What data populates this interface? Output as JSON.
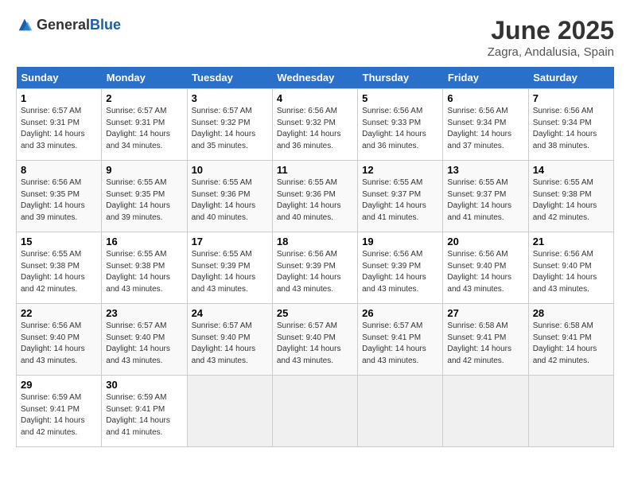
{
  "header": {
    "logo_general": "General",
    "logo_blue": "Blue",
    "title": "June 2025",
    "subtitle": "Zagra, Andalusia, Spain"
  },
  "calendar": {
    "days_of_week": [
      "Sunday",
      "Monday",
      "Tuesday",
      "Wednesday",
      "Thursday",
      "Friday",
      "Saturday"
    ],
    "weeks": [
      [
        {
          "day": "",
          "info": ""
        },
        {
          "day": "2",
          "info": "Sunrise: 6:57 AM\nSunset: 9:31 PM\nDaylight: 14 hours\nand 34 minutes."
        },
        {
          "day": "3",
          "info": "Sunrise: 6:57 AM\nSunset: 9:32 PM\nDaylight: 14 hours\nand 35 minutes."
        },
        {
          "day": "4",
          "info": "Sunrise: 6:56 AM\nSunset: 9:32 PM\nDaylight: 14 hours\nand 36 minutes."
        },
        {
          "day": "5",
          "info": "Sunrise: 6:56 AM\nSunset: 9:33 PM\nDaylight: 14 hours\nand 36 minutes."
        },
        {
          "day": "6",
          "info": "Sunrise: 6:56 AM\nSunset: 9:34 PM\nDaylight: 14 hours\nand 37 minutes."
        },
        {
          "day": "7",
          "info": "Sunrise: 6:56 AM\nSunset: 9:34 PM\nDaylight: 14 hours\nand 38 minutes."
        }
      ],
      [
        {
          "day": "1",
          "info": "Sunrise: 6:57 AM\nSunset: 9:31 PM\nDaylight: 14 hours\nand 33 minutes."
        },
        {
          "day": "",
          "info": ""
        },
        {
          "day": "",
          "info": ""
        },
        {
          "day": "",
          "info": ""
        },
        {
          "day": "",
          "info": ""
        },
        {
          "day": "",
          "info": ""
        },
        {
          "day": "",
          "info": ""
        }
      ],
      [
        {
          "day": "8",
          "info": "Sunrise: 6:56 AM\nSunset: 9:35 PM\nDaylight: 14 hours\nand 39 minutes."
        },
        {
          "day": "9",
          "info": "Sunrise: 6:55 AM\nSunset: 9:35 PM\nDaylight: 14 hours\nand 39 minutes."
        },
        {
          "day": "10",
          "info": "Sunrise: 6:55 AM\nSunset: 9:36 PM\nDaylight: 14 hours\nand 40 minutes."
        },
        {
          "day": "11",
          "info": "Sunrise: 6:55 AM\nSunset: 9:36 PM\nDaylight: 14 hours\nand 40 minutes."
        },
        {
          "day": "12",
          "info": "Sunrise: 6:55 AM\nSunset: 9:37 PM\nDaylight: 14 hours\nand 41 minutes."
        },
        {
          "day": "13",
          "info": "Sunrise: 6:55 AM\nSunset: 9:37 PM\nDaylight: 14 hours\nand 41 minutes."
        },
        {
          "day": "14",
          "info": "Sunrise: 6:55 AM\nSunset: 9:38 PM\nDaylight: 14 hours\nand 42 minutes."
        }
      ],
      [
        {
          "day": "15",
          "info": "Sunrise: 6:55 AM\nSunset: 9:38 PM\nDaylight: 14 hours\nand 42 minutes."
        },
        {
          "day": "16",
          "info": "Sunrise: 6:55 AM\nSunset: 9:38 PM\nDaylight: 14 hours\nand 43 minutes."
        },
        {
          "day": "17",
          "info": "Sunrise: 6:55 AM\nSunset: 9:39 PM\nDaylight: 14 hours\nand 43 minutes."
        },
        {
          "day": "18",
          "info": "Sunrise: 6:56 AM\nSunset: 9:39 PM\nDaylight: 14 hours\nand 43 minutes."
        },
        {
          "day": "19",
          "info": "Sunrise: 6:56 AM\nSunset: 9:39 PM\nDaylight: 14 hours\nand 43 minutes."
        },
        {
          "day": "20",
          "info": "Sunrise: 6:56 AM\nSunset: 9:40 PM\nDaylight: 14 hours\nand 43 minutes."
        },
        {
          "day": "21",
          "info": "Sunrise: 6:56 AM\nSunset: 9:40 PM\nDaylight: 14 hours\nand 43 minutes."
        }
      ],
      [
        {
          "day": "22",
          "info": "Sunrise: 6:56 AM\nSunset: 9:40 PM\nDaylight: 14 hours\nand 43 minutes."
        },
        {
          "day": "23",
          "info": "Sunrise: 6:57 AM\nSunset: 9:40 PM\nDaylight: 14 hours\nand 43 minutes."
        },
        {
          "day": "24",
          "info": "Sunrise: 6:57 AM\nSunset: 9:40 PM\nDaylight: 14 hours\nand 43 minutes."
        },
        {
          "day": "25",
          "info": "Sunrise: 6:57 AM\nSunset: 9:40 PM\nDaylight: 14 hours\nand 43 minutes."
        },
        {
          "day": "26",
          "info": "Sunrise: 6:57 AM\nSunset: 9:41 PM\nDaylight: 14 hours\nand 43 minutes."
        },
        {
          "day": "27",
          "info": "Sunrise: 6:58 AM\nSunset: 9:41 PM\nDaylight: 14 hours\nand 42 minutes."
        },
        {
          "day": "28",
          "info": "Sunrise: 6:58 AM\nSunset: 9:41 PM\nDaylight: 14 hours\nand 42 minutes."
        }
      ],
      [
        {
          "day": "29",
          "info": "Sunrise: 6:59 AM\nSunset: 9:41 PM\nDaylight: 14 hours\nand 42 minutes."
        },
        {
          "day": "30",
          "info": "Sunrise: 6:59 AM\nSunset: 9:41 PM\nDaylight: 14 hours\nand 41 minutes."
        },
        {
          "day": "",
          "info": ""
        },
        {
          "day": "",
          "info": ""
        },
        {
          "day": "",
          "info": ""
        },
        {
          "day": "",
          "info": ""
        },
        {
          "day": "",
          "info": ""
        }
      ]
    ]
  }
}
